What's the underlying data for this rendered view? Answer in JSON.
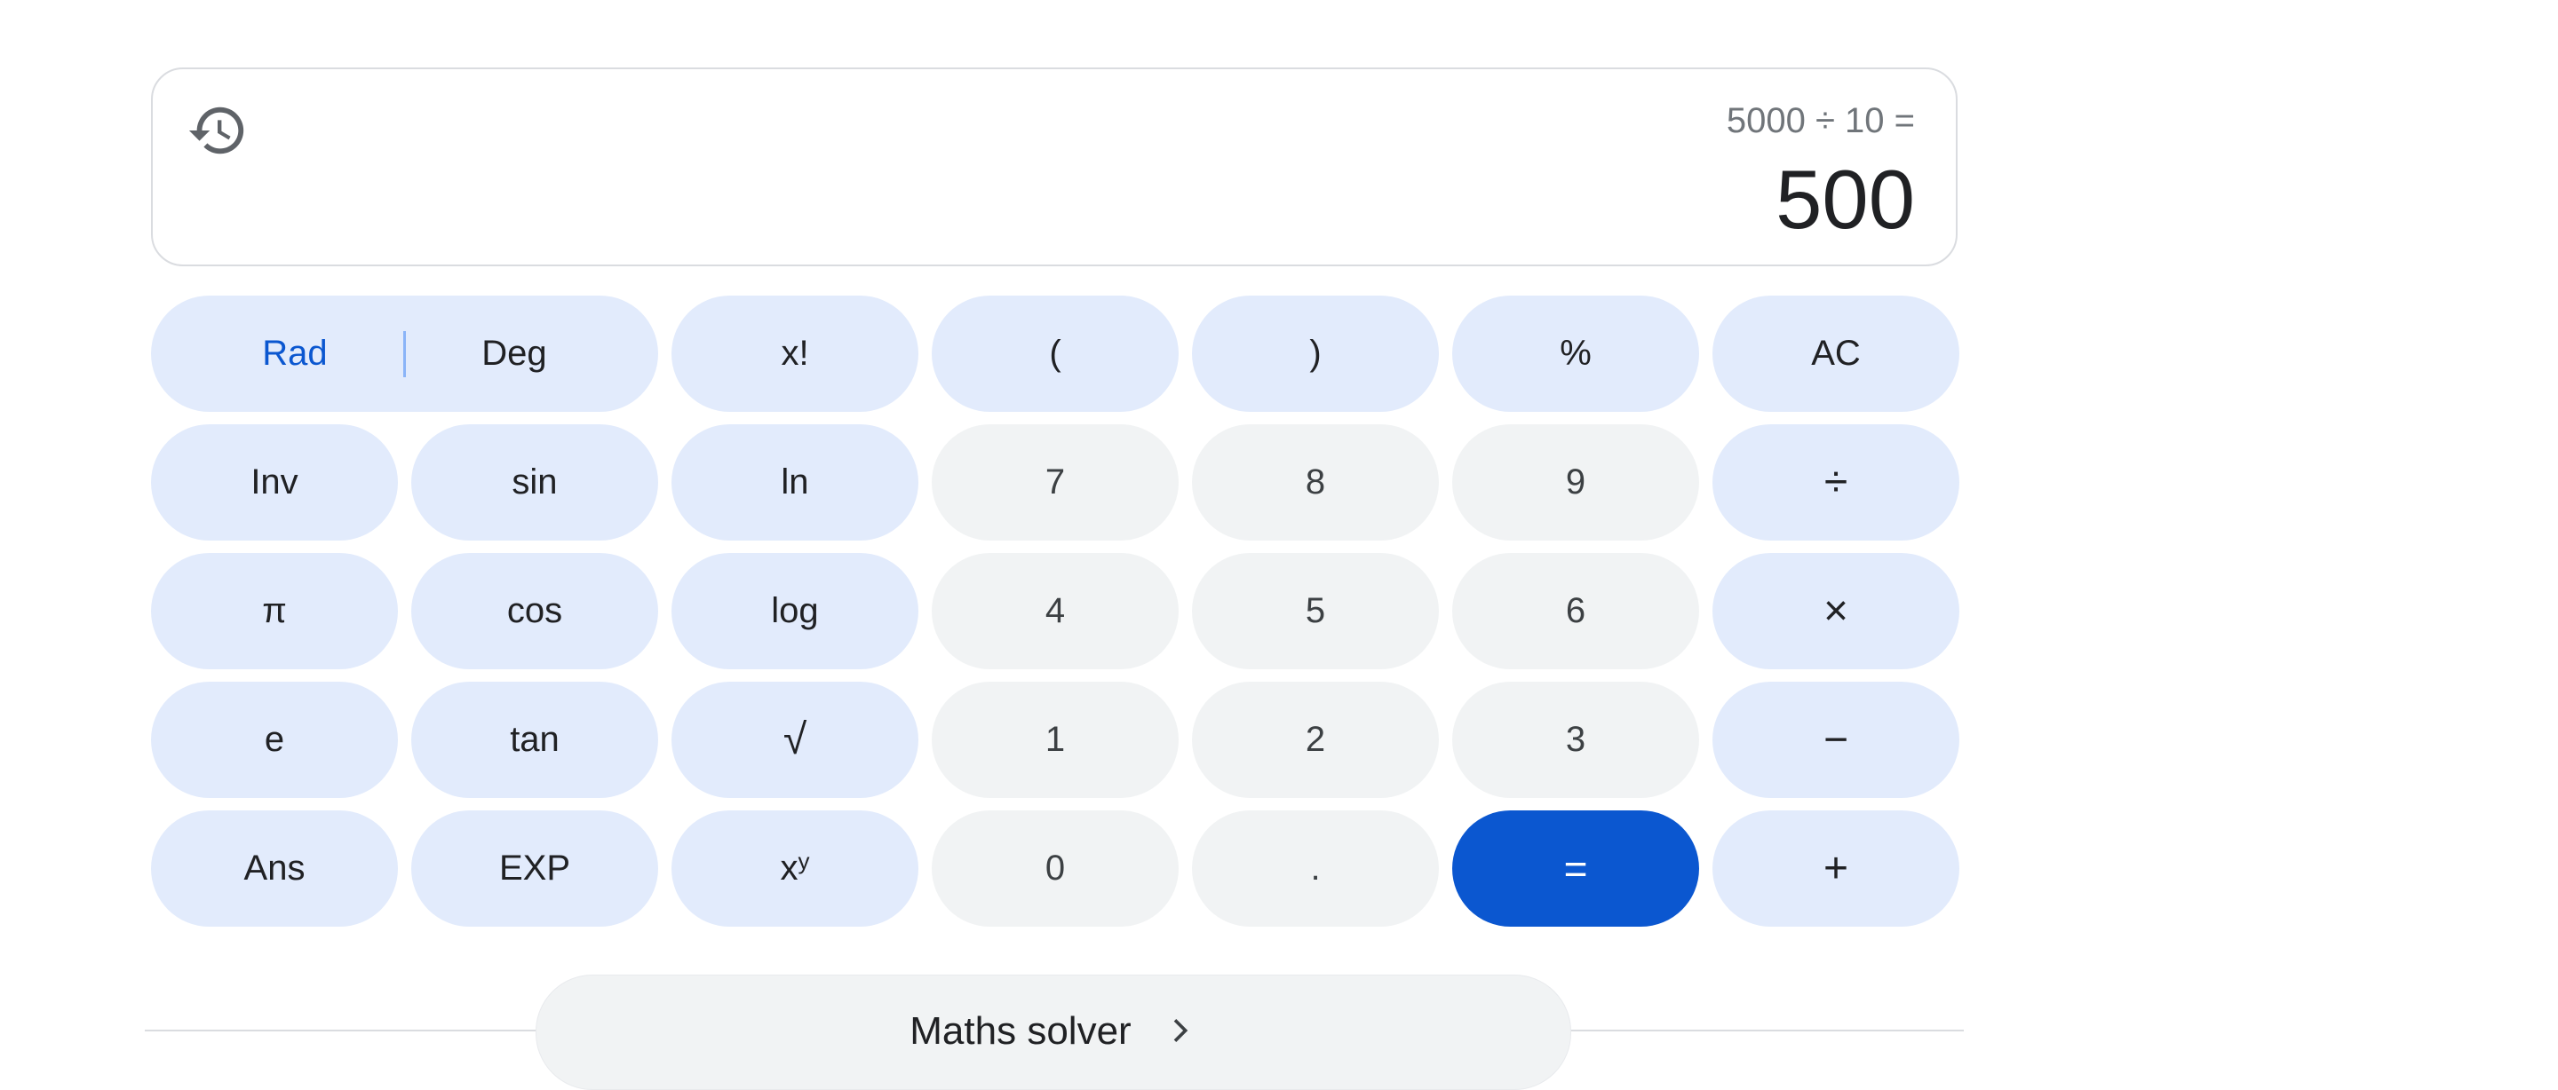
{
  "display": {
    "expression": "5000 ÷ 10 =",
    "result": "500"
  },
  "keys": {
    "rad": "Rad",
    "deg": "Deg",
    "factorial": "x!",
    "open_paren": "(",
    "close_paren": ")",
    "percent": "%",
    "clear": "AC",
    "inv": "Inv",
    "sin": "sin",
    "ln": "ln",
    "seven": "7",
    "eight": "8",
    "nine": "9",
    "divide": "÷",
    "pi": "π",
    "cos": "cos",
    "log": "log",
    "four": "4",
    "five": "5",
    "six": "6",
    "multiply": "×",
    "e": "e",
    "tan": "tan",
    "sqrt": "√",
    "one": "1",
    "two": "2",
    "three": "3",
    "minus": "−",
    "ans": "Ans",
    "exp": "EXP",
    "power_base": "x",
    "power_exp": "y",
    "zero": "0",
    "decimal": ".",
    "equals": "=",
    "plus": "+"
  },
  "solver": {
    "label": "Maths solver"
  },
  "icons": {
    "history": "history-icon",
    "chevron": "chevron-right-icon"
  },
  "colors": {
    "accent": "#0b57d0",
    "function_key": "#e2ebfc",
    "number_key": "#f1f3f4"
  }
}
